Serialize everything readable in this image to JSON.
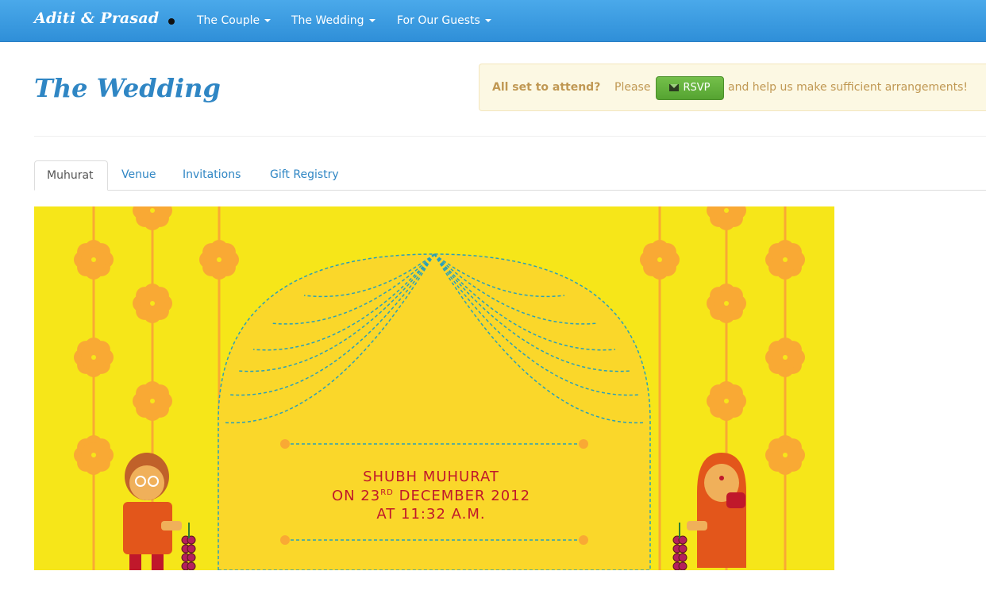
{
  "navbar": {
    "brand": "Aditi & Prasad",
    "items": [
      {
        "label": "The Couple"
      },
      {
        "label": "The Wedding"
      },
      {
        "label": "For Our Guests"
      }
    ]
  },
  "page": {
    "title": "The Wedding"
  },
  "rsvp_notice": {
    "lead": "All set to attend?",
    "please": "Please",
    "button_label": "RSVP",
    "tail": "and help us make sufficient arrangements!"
  },
  "tabs": [
    {
      "label": "Muhurat",
      "active": true
    },
    {
      "label": "Venue",
      "active": false
    },
    {
      "label": "Invitations",
      "active": false
    },
    {
      "label": "Gift Registry",
      "active": false
    }
  ],
  "banner": {
    "line1": "SHUBH MUHURAT",
    "line2_prefix": "ON 23",
    "line2_sup": "RD",
    "line2_suffix": " DECEMBER 2012",
    "line3": "AT 11:32 A.M.",
    "colors": {
      "background": "#f6e619",
      "flower": "#f9a934",
      "arch_fill": "#fad72a",
      "dashes": "#2aa0b8",
      "text": "#c0182b"
    }
  }
}
